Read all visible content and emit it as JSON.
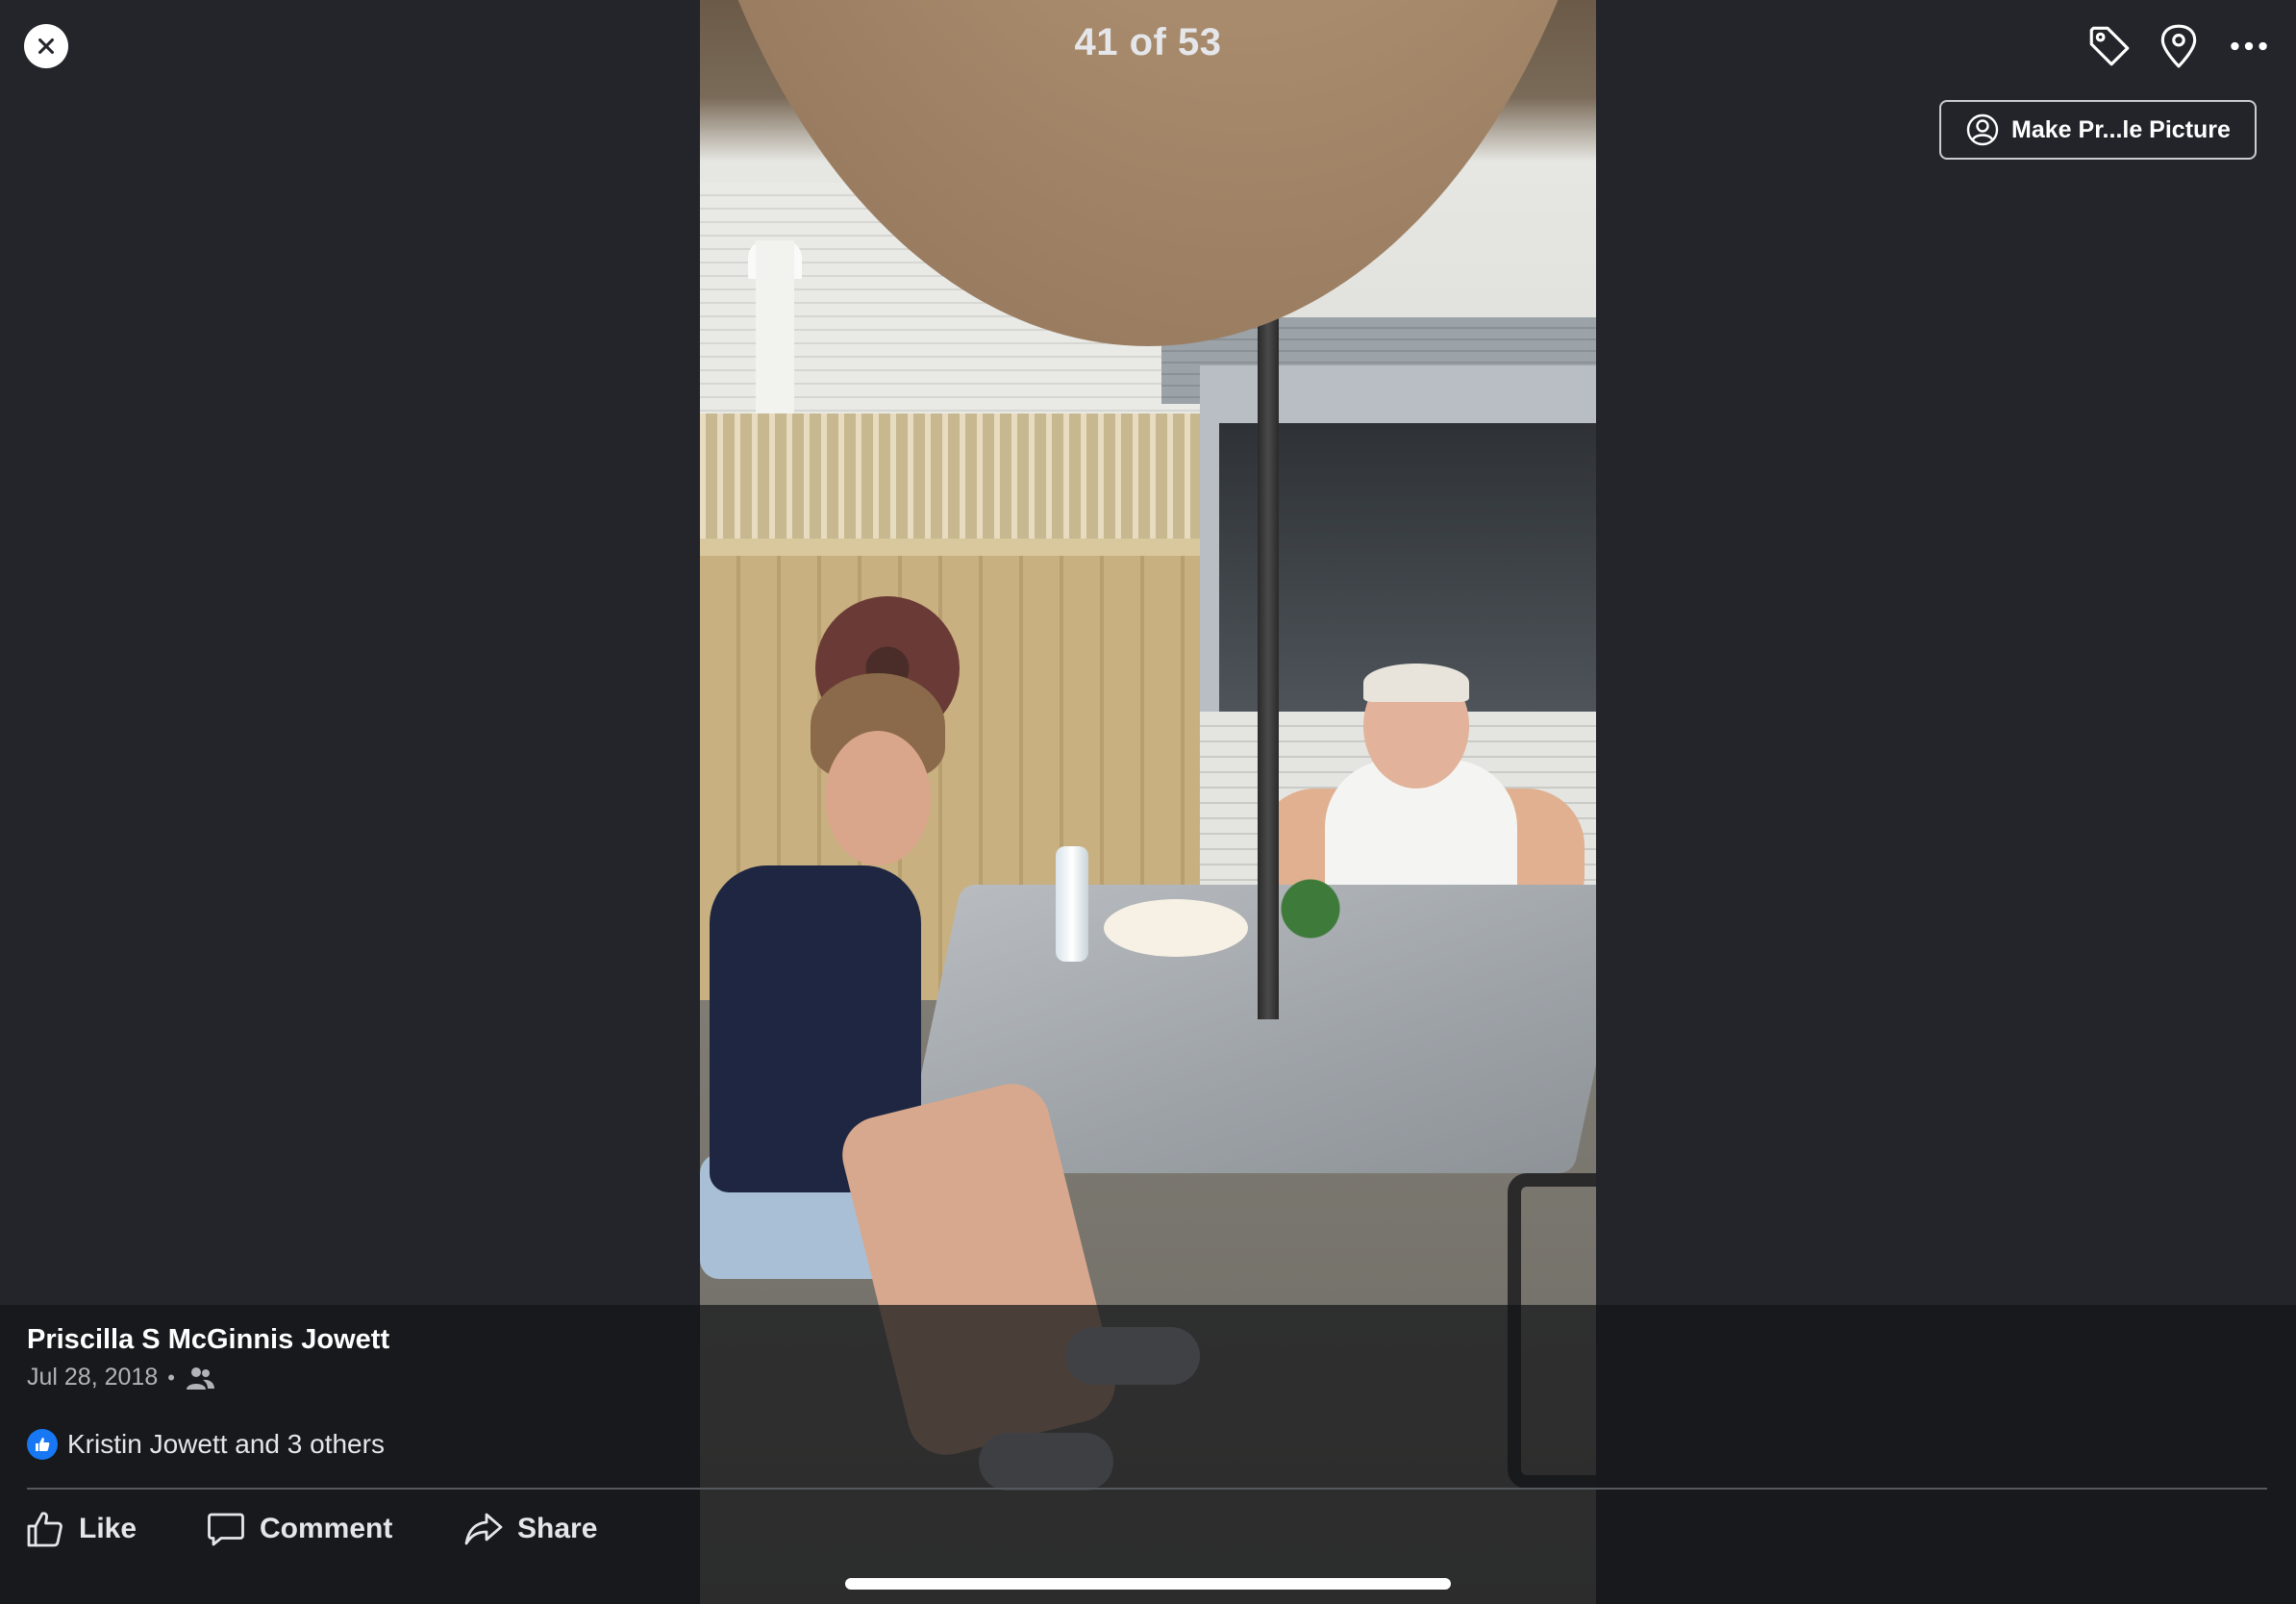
{
  "viewer": {
    "counter": "41 of 53",
    "make_profile_label": "Make Pr...le Picture",
    "icons": {
      "close": "close-icon",
      "tag": "tag-icon",
      "location": "location-pin-icon",
      "more": "more-icon"
    }
  },
  "post": {
    "author": "Priscilla S McGinnis Jowett",
    "date": "Jul 28, 2018",
    "separator": "•",
    "audience_icon": "friends-icon",
    "reactions_text": "Kristin Jowett and 3 others"
  },
  "actions": {
    "like": "Like",
    "comment": "Comment",
    "share": "Share"
  },
  "colors": {
    "background": "#23252a",
    "like_blue": "#1877f2",
    "text_primary": "#e4e6ea",
    "text_secondary": "#b0b3b8"
  }
}
